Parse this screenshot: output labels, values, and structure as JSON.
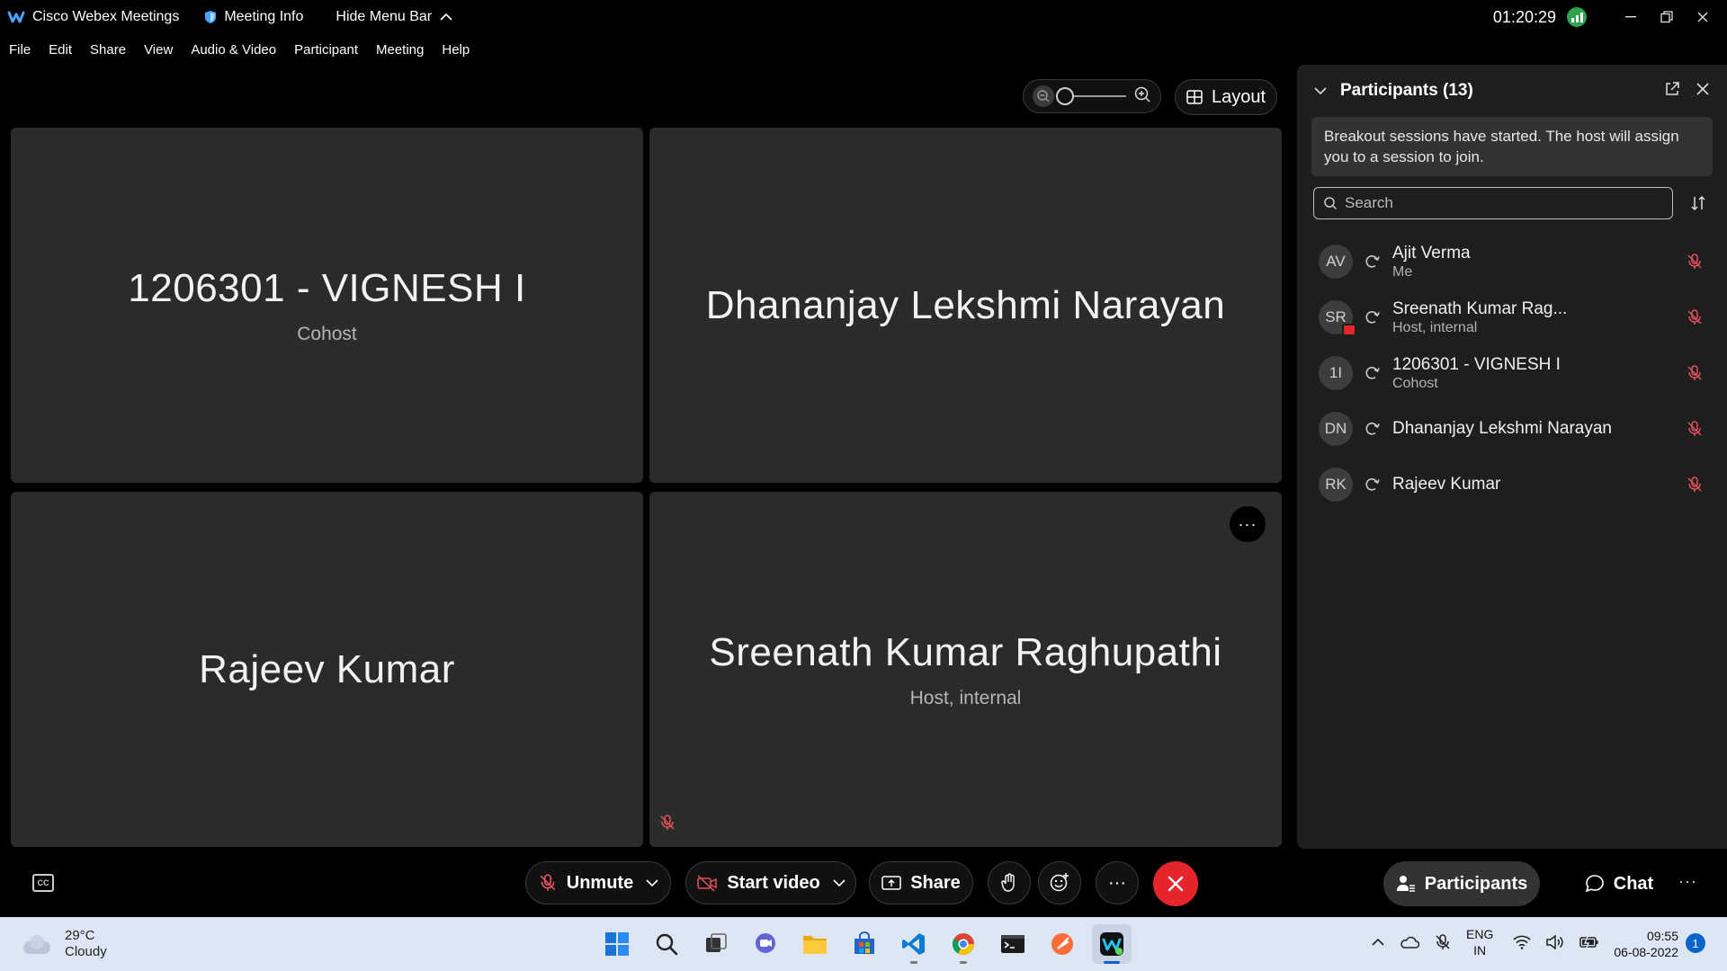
{
  "titlebar": {
    "app_name": "Cisco Webex Meetings",
    "meeting_info": "Meeting Info",
    "hide_menu": "Hide Menu Bar",
    "time": "01:20:29"
  },
  "menu": [
    "File",
    "Edit",
    "Share",
    "View",
    "Audio & Video",
    "Participant",
    "Meeting",
    "Help"
  ],
  "toolbar": {
    "layout_label": "Layout"
  },
  "tiles": [
    {
      "name": "1206301 - VIGNESH I",
      "role": "Cohost"
    },
    {
      "name": "Dhananjay Lekshmi Narayan",
      "role": ""
    },
    {
      "name": "Rajeev Kumar",
      "role": ""
    },
    {
      "name": "Sreenath Kumar Raghupathi",
      "role": "Host, internal",
      "more": "···"
    }
  ],
  "controls": {
    "cc": "CC",
    "unmute": "Unmute",
    "start_video": "Start video",
    "share": "Share",
    "more": "···",
    "participants": "Participants",
    "chat": "Chat",
    "panel_more": "···"
  },
  "panel": {
    "title": "Participants (13)",
    "notice": "Breakout sessions have started. The host will assign you to a session to join.",
    "search_placeholder": "Search",
    "participants": [
      {
        "initials": "AV",
        "name": "Ajit Verma",
        "sub": "Me"
      },
      {
        "initials": "SR",
        "name": "Sreenath Kumar Rag...",
        "sub": "Host, internal"
      },
      {
        "initials": "1I",
        "name": "1206301 - VIGNESH I",
        "sub": "Cohost"
      },
      {
        "initials": "DN",
        "name": "Dhananjay Lekshmi Narayan",
        "sub": ""
      },
      {
        "initials": "RK",
        "name": "Rajeev Kumar",
        "sub": ""
      }
    ]
  },
  "taskbar": {
    "weather_temp": "29°C",
    "weather_desc": "Cloudy",
    "lang_1": "ENG",
    "lang_2": "IN",
    "clock_time": "09:55",
    "clock_date": "06-08-2022",
    "notifications": "1"
  },
  "colors": {
    "end_call": "#e5252b",
    "tile_bg": "#2b2b2b",
    "panel_bg": "#1e1e1e",
    "taskbar_bg": "#dce6f4",
    "mute_red": "#e5525b"
  }
}
